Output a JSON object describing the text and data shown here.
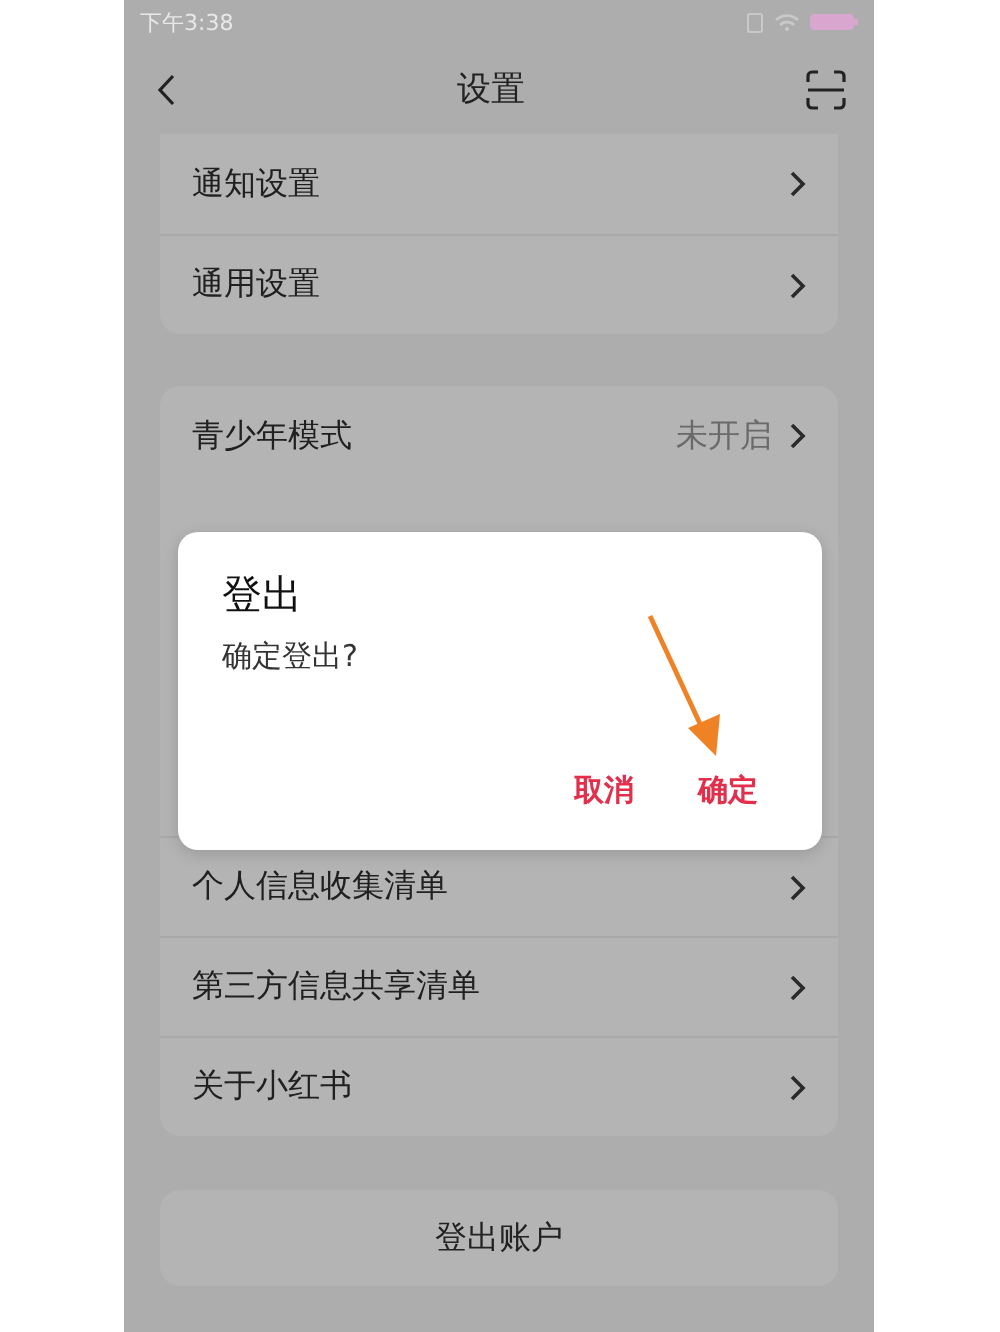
{
  "status_bar": {
    "time": "下午3:38"
  },
  "nav": {
    "title": "设置"
  },
  "groups": [
    {
      "items": [
        {
          "kind": "row",
          "label": "通知设置"
        },
        {
          "kind": "row",
          "label": "通用设置"
        }
      ]
    },
    {
      "items": [
        {
          "kind": "row",
          "label": "青少年模式",
          "value": "未开启"
        },
        {
          "kind": "covered"
        },
        {
          "kind": "row",
          "label": "个人信息收集清单"
        },
        {
          "kind": "row",
          "label": "第三方信息共享清单"
        },
        {
          "kind": "row",
          "label": "关于小红书"
        }
      ]
    }
  ],
  "logout": {
    "label": "登出账户"
  },
  "dialog": {
    "title": "登出",
    "message": "确定登出?",
    "buttons": [
      "取消",
      "确定"
    ]
  },
  "annotation": {
    "kind": "arrow"
  }
}
